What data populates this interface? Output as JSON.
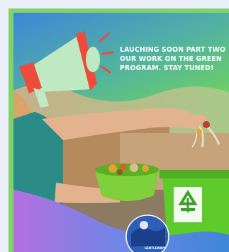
{
  "banner": {
    "line1": "LAUCHING SOON PART TWO",
    "line2": "OUR WORK ON THE GREEN",
    "line3": "PROGRAM. STAY TUNED!"
  },
  "logo": {
    "text": "GENTLEWAYS"
  },
  "icons": [
    "megaphone-icon",
    "recycle-icon"
  ],
  "colors": {
    "frame_green": "#7fd36a",
    "gradient_blue": "#3f86d9",
    "gradient_green": "#6fd35e",
    "gradient_purple": "#b46fe0",
    "bin_green": "#5fca2c",
    "megaphone_red": "#ee4b3b",
    "megaphone_green": "#bfe9c2"
  }
}
